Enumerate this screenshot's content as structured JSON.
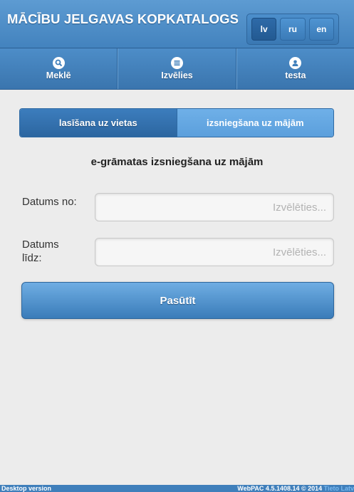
{
  "header": {
    "title": "MĀCĪBU JELGAVAS KOPKATALOGS",
    "languages": [
      {
        "label": "lv",
        "active": true
      },
      {
        "label": "ru",
        "active": false
      },
      {
        "label": "en",
        "active": false
      }
    ]
  },
  "nav": {
    "items": [
      {
        "label": "Meklē",
        "icon": "search-icon"
      },
      {
        "label": "Izvēlies",
        "icon": "list-icon"
      },
      {
        "label": "testa",
        "icon": "user-icon"
      }
    ]
  },
  "tabs": [
    {
      "label": "lasīšana uz vietas",
      "active": false
    },
    {
      "label": "izsniegšana uz mājām",
      "active": true
    }
  ],
  "section_title": "e-grāmatas izsniegšana uz mājām",
  "form": {
    "date_from": {
      "label": "Datums no:",
      "placeholder": "Izvēlēties...",
      "value": ""
    },
    "date_to": {
      "label": "Datums līdz:",
      "placeholder": "Izvēlēties...",
      "value": ""
    },
    "submit_label": "Pasūtīt"
  },
  "footer": {
    "desktop_link": "Desktop version",
    "version": "WebPAC 4.5.1408.14 © 2014",
    "company": "Tieto Latv"
  },
  "colors": {
    "accent": "#3f7fbb",
    "active_tab": "#5b9fdc",
    "background": "#ececec"
  }
}
